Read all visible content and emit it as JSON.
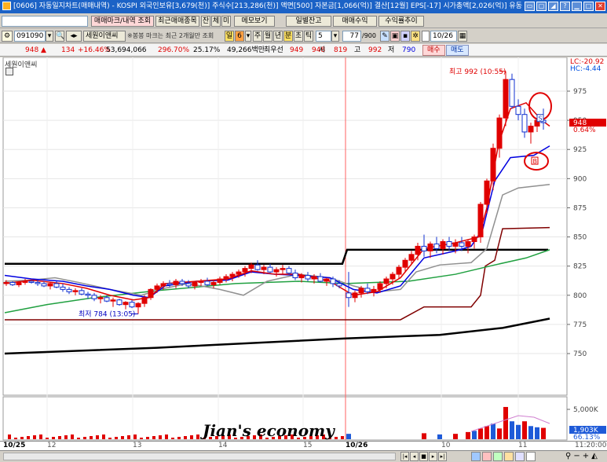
{
  "window": {
    "title": "[0606] 자동일지차트(매매내역) - KOSPI 외국인보유[3,679(천)] 주식수[213,286(천)] 액면[500] 자본금[1,066(억)] 결산[12월] EPS[-17] 시가총액[2,026(억)] 유동",
    "controls": [
      "▭",
      "▢",
      "◢",
      "?",
      "▁",
      "□",
      "✕"
    ]
  },
  "toolbar1": {
    "buttons": [
      "매매마크/내역 조회",
      "최근매매종목",
      "잔",
      "체",
      "미",
      "메모보기",
      "일별잔고",
      "매매수익",
      "수익률추이"
    ]
  },
  "toolbar2": {
    "code": "091090",
    "stock_name": "세원이앤씨",
    "note": "※봉봉 마크는 최근 2개월만 조회",
    "periods": [
      "일",
      "6",
      "주",
      "월",
      "년",
      "분",
      "초",
      "틱"
    ],
    "minute_value": "5",
    "count_value": "77",
    "count_total": "/900",
    "date_value": "10/26"
  },
  "quote": {
    "price": "948 ▲",
    "change": "134",
    "change_pct": "+16.46%",
    "volume": "53,694,066",
    "vol_ratio": "296.70%",
    "turnover": "25.17%",
    "amount": "49,266백만",
    "priority_label": "최우선",
    "priority_value": "949",
    "current_value": "948",
    "open_label": "시",
    "open_value": "819",
    "high_label": "고",
    "high_value": "992",
    "low_label": "저",
    "low_value": "790",
    "buy_label": "매수",
    "sell_label": "매도"
  },
  "chart": {
    "legend": "세원이앤씨",
    "lc": "LC:-20.92",
    "hc": "HC:-4.44",
    "high_note": "최고 992 (10:55)",
    "low_note": "최저 784 (13:05)",
    "current_price_tag": "948",
    "current_pct_tag": "0.64%",
    "marker_s": "S",
    "marker_b": "B",
    "price_ticks": [
      "975",
      "950",
      "925",
      "900",
      "875",
      "850",
      "825",
      "800",
      "775",
      "750"
    ],
    "vol_tick": "5,000K",
    "vol_tag": "1,903K",
    "vol_pct": "66.13%",
    "watermark": "Jian's economy",
    "date_labels": [
      "10/25",
      "12",
      "13",
      "14",
      "15",
      "10/26",
      "10",
      "11"
    ],
    "time_label": "11:20:00"
  },
  "colors": {
    "up": "#e00000",
    "down": "#1030d0",
    "ma5": "#e00000",
    "ma10": "#0000e0",
    "ma20": "#909090",
    "ma60": "#20a040",
    "dark_red_line": "#800000",
    "thick_line": "#000000"
  },
  "icons": [
    "settings-icon",
    "search-icon",
    "arrows-icon",
    "prev-icon",
    "next-icon",
    "zoom-in-icon",
    "zoom-out-icon"
  ]
}
